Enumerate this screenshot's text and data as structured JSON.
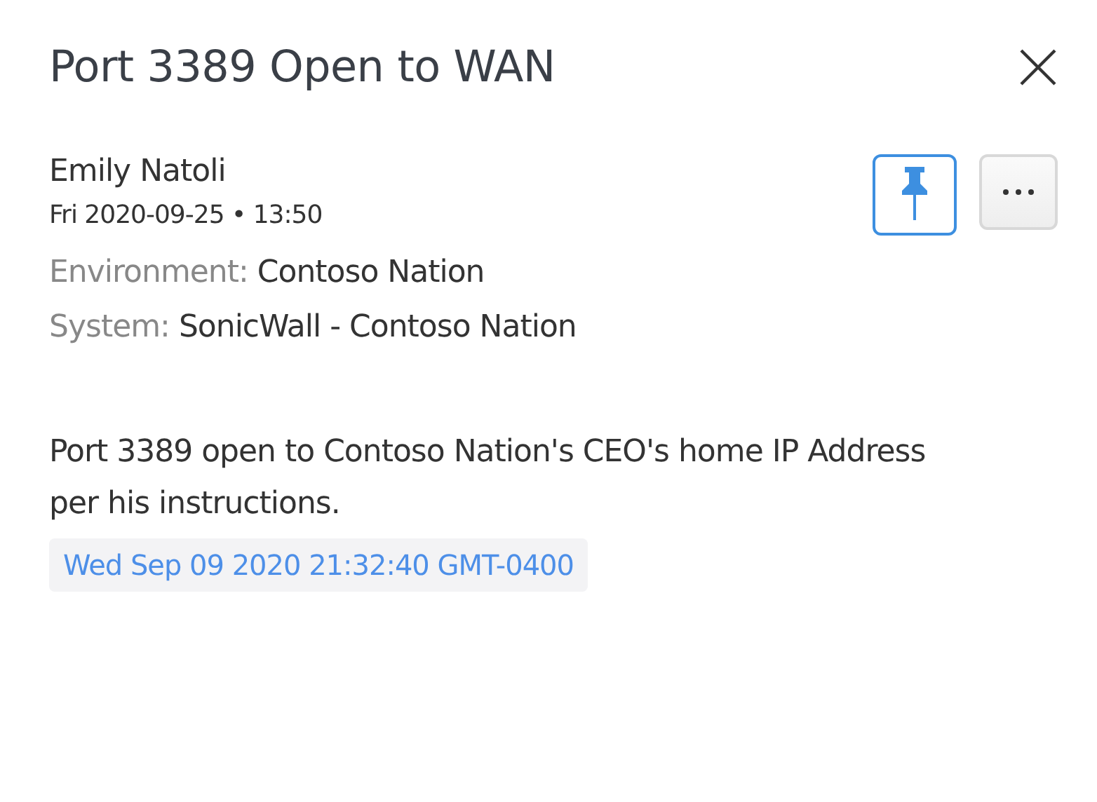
{
  "title": "Port 3389 Open to WAN",
  "author": "Emily Natoli",
  "timestamp": "Fri 2020-09-25 • 13:50",
  "pinned": true,
  "fields": [
    {
      "label": "Environment:",
      "value": "Contoso Nation"
    },
    {
      "label": "System:",
      "value": "SonicWall - Contoso Nation"
    }
  ],
  "body": "Port 3389 open to Contoso Nation's CEO's home IP Address per his instructions.",
  "tag": "Wed Sep 09 2020 21:32:40 GMT-0400"
}
